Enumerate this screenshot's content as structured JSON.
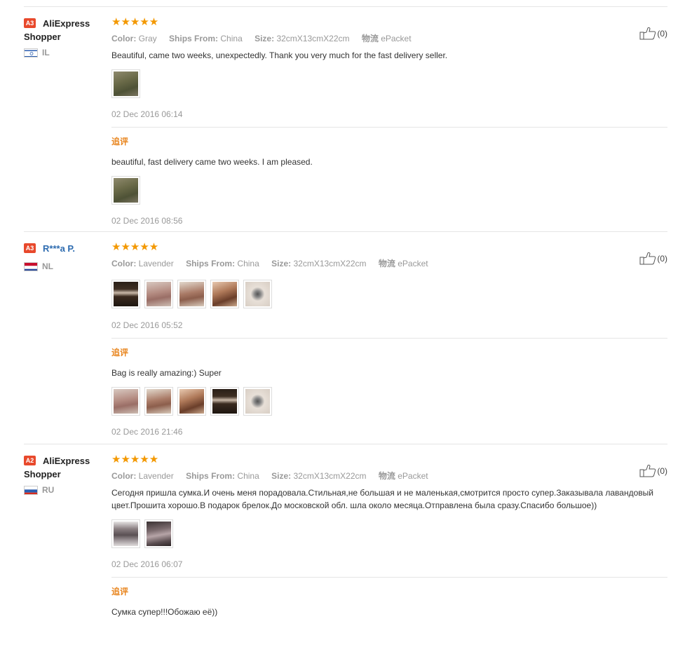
{
  "reviews": [
    {
      "badge": "A3",
      "name": "AliExpress",
      "name_cont": "Shopper",
      "country": "IL",
      "stars": "★★★★★",
      "like_count": "(0)",
      "attrs": {
        "color_label": "Color:",
        "color": "Gray",
        "ships_label": "Ships From:",
        "ships": "China",
        "size_label": "Size:",
        "size": "32cmX13cmX22cm",
        "logistics_label": "物流",
        "logistics": "ePacket"
      },
      "text": "Beautiful, came two weeks, unexpectedly. Thank you very much for the fast delivery seller.",
      "date": "02 Dec 2016 06:14",
      "append_label": "追评",
      "append_text": "beautiful, fast delivery came two weeks. I am pleased.",
      "append_date": "02 Dec 2016 08:56"
    },
    {
      "badge": "A3",
      "name": "R***a P.",
      "country": "NL",
      "stars": "★★★★★",
      "like_count": "(0)",
      "attrs": {
        "color_label": "Color:",
        "color": "Lavender",
        "ships_label": "Ships From:",
        "ships": "China",
        "size_label": "Size:",
        "size": "32cmX13cmX22cm",
        "logistics_label": "物流",
        "logistics": "ePacket"
      },
      "date": "02 Dec 2016 05:52",
      "append_label": "追评",
      "append_text": "Bag is really amazing:) Super",
      "append_date": "02 Dec 2016 21:46"
    },
    {
      "badge": "A2",
      "name": "AliExpress",
      "name_cont": "Shopper",
      "country": "RU",
      "stars": "★★★★★",
      "like_count": "(0)",
      "attrs": {
        "color_label": "Color:",
        "color": "Lavender",
        "ships_label": "Ships From:",
        "ships": "China",
        "size_label": "Size:",
        "size": "32cmX13cmX22cm",
        "logistics_label": "物流",
        "logistics": "ePacket"
      },
      "text": "Сегодня пришла сумка.И очень меня порадовала.Стильная,не большая и не маленькая,смотрится просто супер.Заказывала лавандовый цвет.Прошита хорошо.В подарок брелок.До московской обл. шла около месяца.Отправлена была сразу.Спасибо большое))",
      "date": "02 Dec 2016 06:07",
      "append_label": "追评",
      "append_text": "Сумка супер!!!Обожаю её))"
    }
  ]
}
